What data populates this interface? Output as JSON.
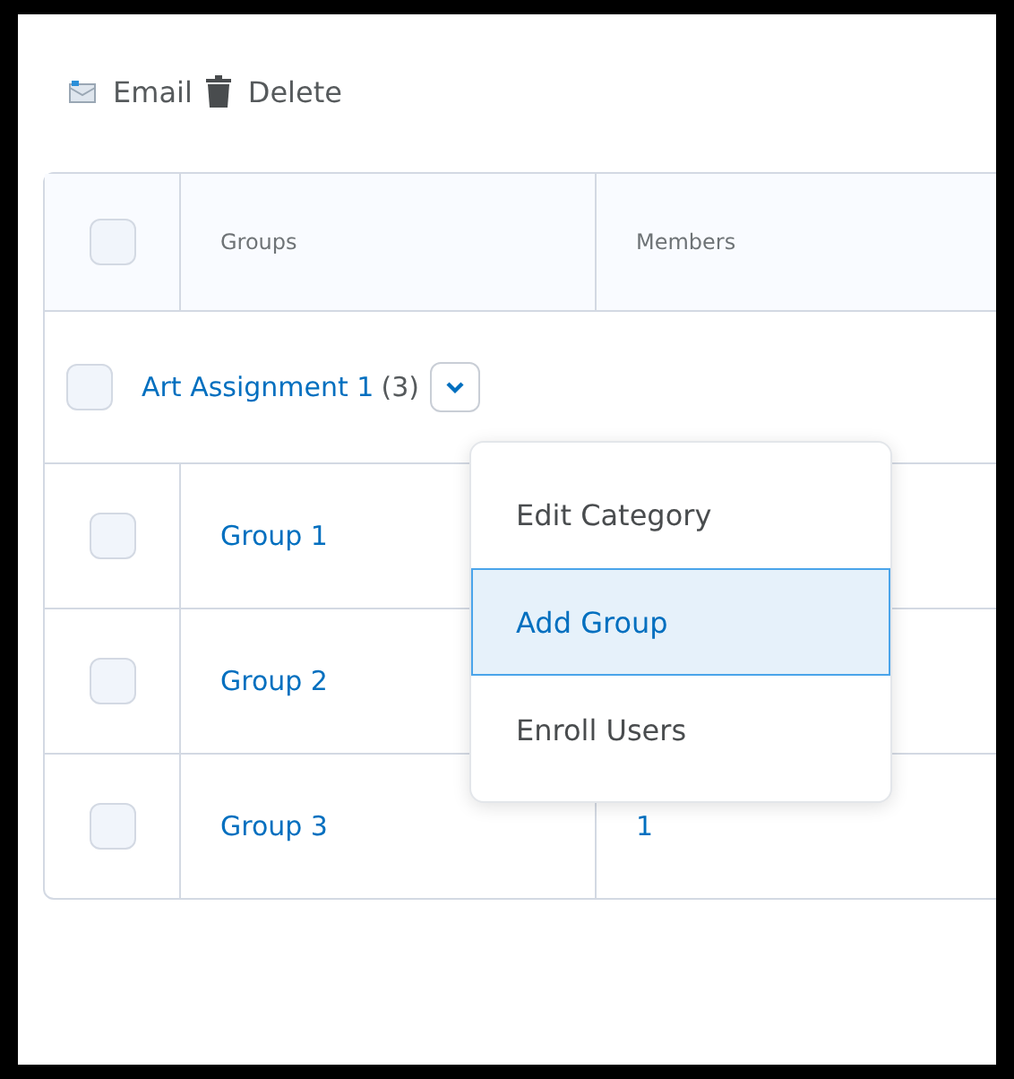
{
  "toolbar": [
    {
      "kind": "email",
      "label": "Email"
    },
    {
      "kind": "delete",
      "label": "Delete"
    }
  ],
  "table": {
    "header_checked": false,
    "columns": [
      "Groups",
      "Members"
    ],
    "category": {
      "name": "Art Assignment 1",
      "count": "(3)",
      "checked": false
    },
    "rows": [
      {
        "name": "Group 1",
        "members": "",
        "checked": false
      },
      {
        "name": "Group 2",
        "members": "",
        "checked": false
      },
      {
        "name": "Group 3",
        "members": "1",
        "checked": false
      }
    ]
  },
  "menu": [
    {
      "label": "Edit Category",
      "selected": false
    },
    {
      "label": "Add Group",
      "selected": true
    },
    {
      "label": "Enroll Users",
      "selected": false
    }
  ]
}
